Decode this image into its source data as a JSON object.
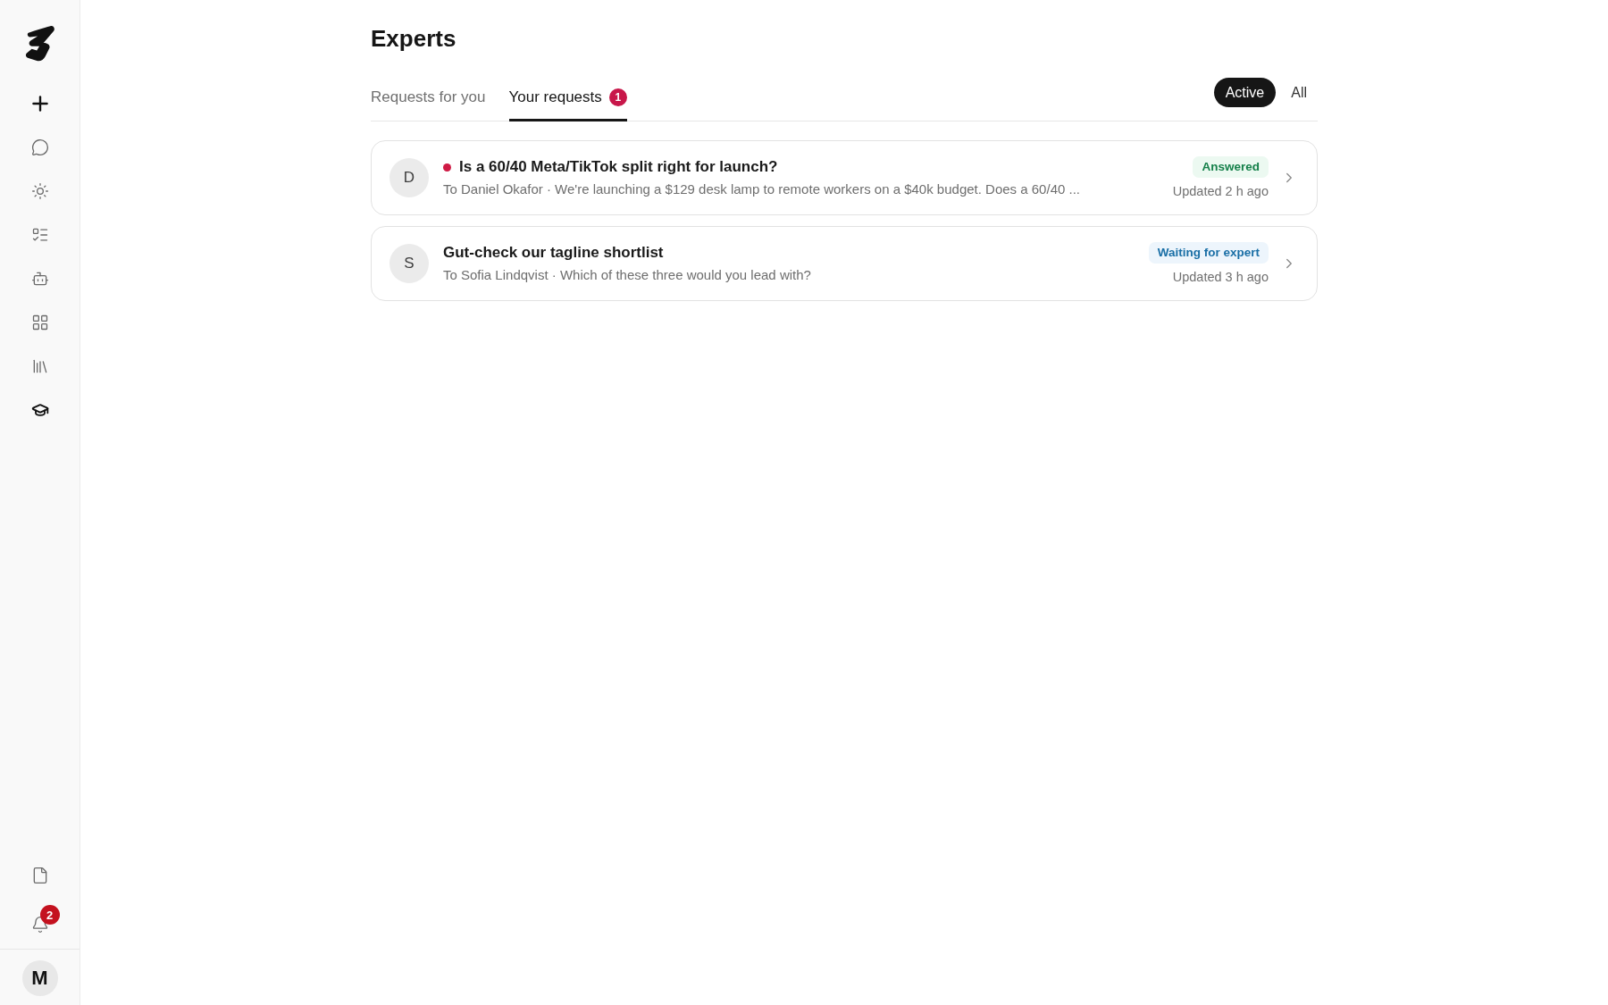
{
  "sidebar": {
    "nav_items": [
      {
        "selected": false
      },
      {
        "selected": false
      },
      {
        "selected": false
      },
      {
        "selected": false
      },
      {
        "selected": false
      },
      {
        "selected": false
      },
      {
        "selected": true
      }
    ],
    "notifications": {
      "count": "2"
    },
    "user": {
      "initial": "M"
    }
  },
  "page": {
    "title": "Experts"
  },
  "tabs": [
    {
      "label": "Requests for you",
      "selected": false
    },
    {
      "label": "Your requests",
      "selected": true,
      "badge": "1"
    }
  ],
  "filters": [
    {
      "label": "Active",
      "selected": true
    },
    {
      "label": "All",
      "selected": false
    }
  ],
  "requests": [
    {
      "initial": "D",
      "unread": true,
      "title": "Is a 60/40 Meta/TikTok split right for launch?",
      "subtitle": "To Daniel Okafor · We're launching a $129 desk lamp to remote workers on a $40k budget. Does a 60/40 ...",
      "status": {
        "label": "Answered",
        "kind": "answered"
      },
      "updated": "Updated 2 h ago"
    },
    {
      "initial": "S",
      "unread": false,
      "title": "Gut-check our tagline shortlist",
      "subtitle": "To Sofia Lindqvist · Which of these three would you lead with?",
      "status": {
        "label": "Waiting for expert",
        "kind": "waiting"
      },
      "updated": "Updated 3 h ago"
    }
  ]
}
